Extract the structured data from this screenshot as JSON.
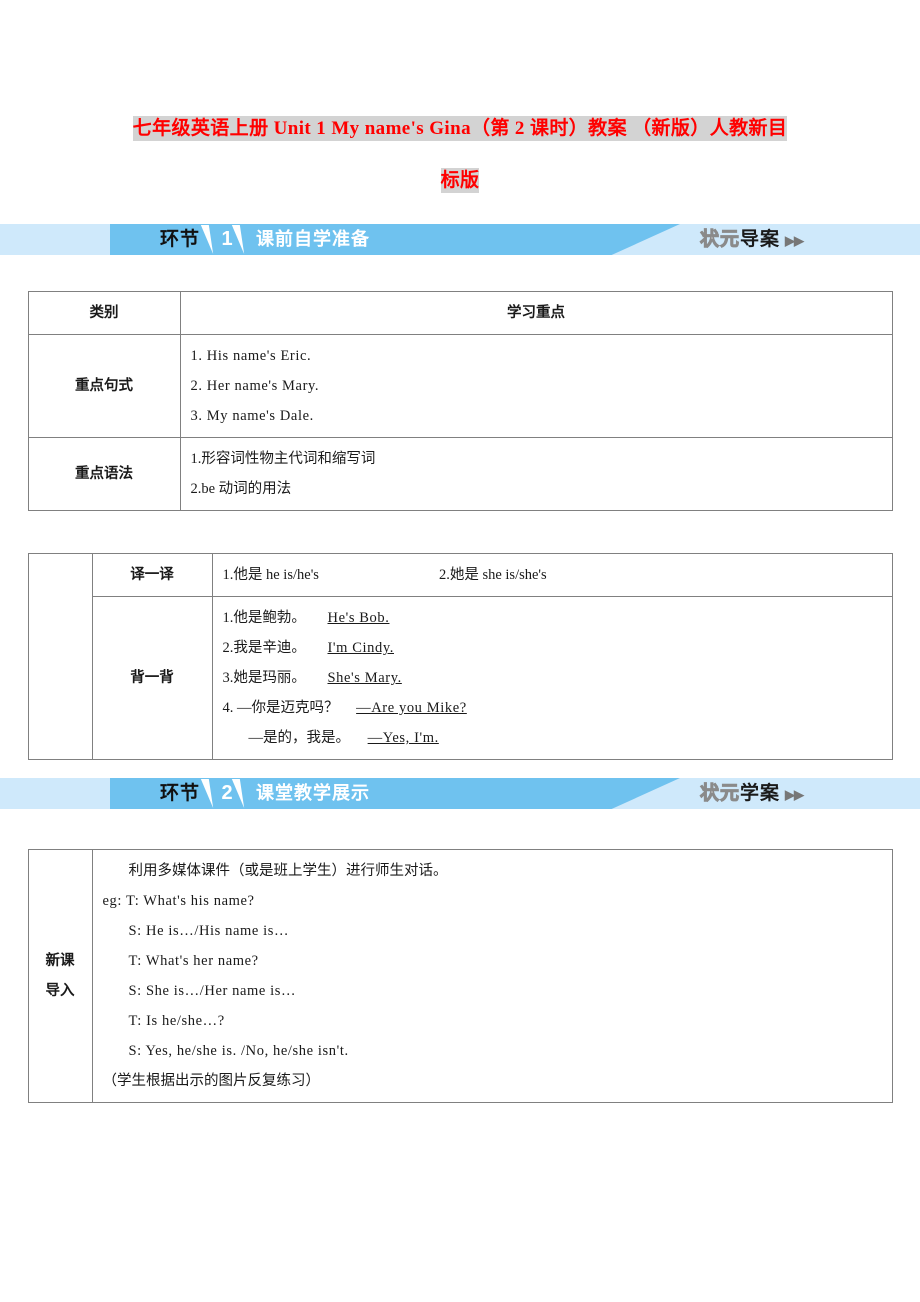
{
  "title": {
    "line1": "七年级英语上册 Unit 1 My name's Gina（第 2 课时）教案 （新版）人教新目",
    "line2": "标版",
    "color": "#ff0000",
    "highlight": "#d3d3d3"
  },
  "banners": [
    {
      "prefix": "环节",
      "number": "1",
      "label": "课前自学准备",
      "brand_light": "状元",
      "brand_bold": "导案",
      "arrows": "▶▶",
      "band_color": "#6fc2ef",
      "bg_color": "#cfe9fb"
    },
    {
      "prefix": "环节",
      "number": "2",
      "label": "课堂教学展示",
      "brand_light": "状元",
      "brand_bold": "学案",
      "arrows": "▶▶",
      "band_color": "#6fc2ef",
      "bg_color": "#cfe9fb"
    }
  ],
  "table1": {
    "header": {
      "col1": "类别",
      "col2": "学习重点"
    },
    "rows": [
      {
        "label": "重点句式",
        "lines": [
          "1. His name's Eric.",
          "2. Her name's Mary.",
          "3. My name's Dale."
        ]
      },
      {
        "label": "重点语法",
        "lines": [
          "1.形容词性物主代词和缩写词",
          "2.be 动词的用法"
        ]
      }
    ]
  },
  "table2": {
    "rows": [
      {
        "label": "译一译",
        "item_a": "1.他是 he is/he's",
        "item_b": "2.她是 she is/she's"
      },
      {
        "label": "背一背",
        "lines": [
          {
            "cn": "1.他是鲍勃。",
            "ans": "He's Bob."
          },
          {
            "cn": "2.我是辛迪。",
            "ans": "I'm Cindy."
          },
          {
            "cn": "3.她是玛丽。",
            "ans": "She's Mary."
          },
          {
            "cn": "4. —你是迈克吗？",
            "ans": "—Are you Mike?"
          },
          {
            "cn": "—是的，我是。",
            "ans": "—Yes, I'm."
          }
        ]
      }
    ]
  },
  "table3": {
    "label_line1": "新课",
    "label_line2": "导入",
    "lines": [
      "利用多媒体课件（或是班上学生）进行师生对话。",
      "eg: T: What's his name?",
      "S: He is…/His name is…",
      "T: What's her name?",
      "S: She is…/Her name is…",
      "T: Is he/she…?",
      "S: Yes, he/she is. /No, he/she isn't.",
      "（学生根据出示的图片反复练习）"
    ]
  }
}
